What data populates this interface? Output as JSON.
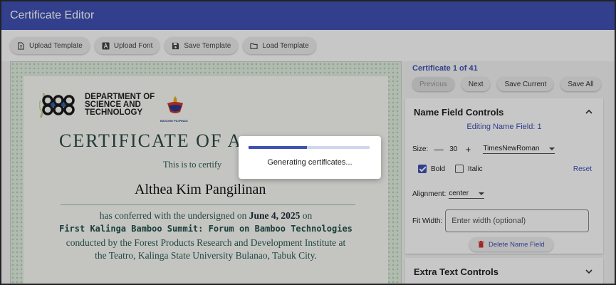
{
  "app": {
    "title": "Certificate Editor"
  },
  "toolbar": {
    "upload_template": "Upload Template",
    "upload_font": "Upload Font",
    "save_template": "Save Template",
    "load_template": "Load Template"
  },
  "certificate": {
    "org_line1": "DEPARTMENT OF",
    "org_line2": "SCIENCE AND",
    "org_line3": "TECHNOLOGY",
    "seal_caption": "BAGONG PILIPINAS",
    "title": "CERTIFICATE OF A",
    "certify": "This is to certify",
    "recipient": "Althea Kim Pangilinan",
    "conferred_prefix": "has conferred with the undersigned on ",
    "conferred_date": "June 4, 2025",
    "conferred_suffix": " on",
    "event": "First Kalinga Bamboo Summit: Forum on Bamboo Technologies",
    "body_line1": "conducted by the Forest Products Research and Development Institute at",
    "body_line2": "the Teatro, Kalinga State University Bulanao, Tabuk City."
  },
  "panel": {
    "counter": "Certificate 1 of 41",
    "previous": "Previous",
    "next": "Next",
    "save_current": "Save Current",
    "save_all": "Save All",
    "name_section_title": "Name Field Controls",
    "editing_label": "Editing Name Field: 1",
    "size_label": "Size:",
    "size_decrement": "—",
    "size_value": "30",
    "size_increment": "+",
    "font_value": "TimesNewRoman",
    "bold_label": "Bold",
    "bold_checked": true,
    "italic_label": "Italic",
    "italic_checked": false,
    "reset": "Reset",
    "alignment_label": "Alignment:",
    "alignment_value": "center",
    "fit_width_label": "Fit Width:",
    "fit_width_placeholder": "Enter width (optional)",
    "delete_name_field": "Delete Name Field",
    "extra_section_title": "Extra Text Controls"
  },
  "modal": {
    "message": "Generating certificates...",
    "progress": 0.48
  },
  "colors": {
    "primary": "#3f51b5",
    "delete_icon": "#d32f2f"
  }
}
